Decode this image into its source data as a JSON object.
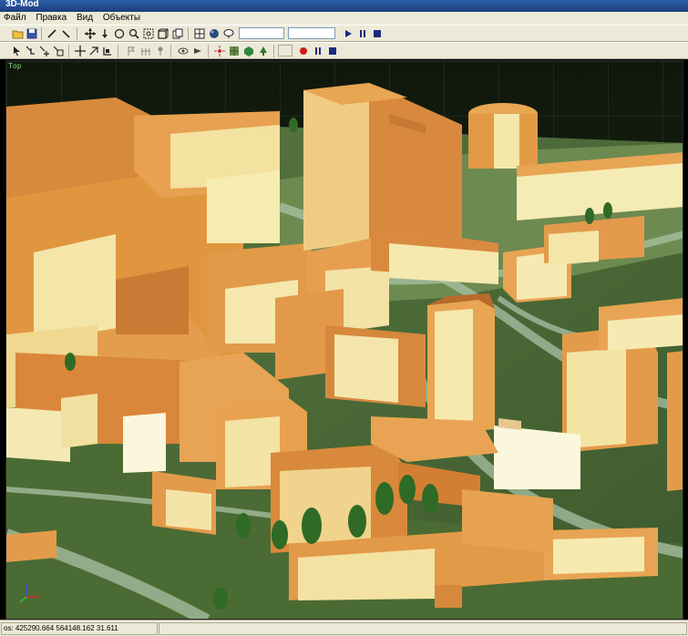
{
  "window": {
    "title": "3D-Mod"
  },
  "menu": [
    {
      "label": "Файл"
    },
    {
      "label": "Правка"
    },
    {
      "label": "Вид"
    },
    {
      "label": "Объекты"
    }
  ],
  "toolbar1": {
    "icons": [
      "open-icon",
      "save-icon",
      "line-icon",
      "polyline-icon",
      "pan-icon",
      "move-down-icon",
      "rotate-icon",
      "zoom-icon",
      "zoom-region-icon",
      "box-icon",
      "copy-icon",
      "grid-icon",
      "sphere-icon",
      "cloud-icon",
      "play-icon",
      "pause-icon",
      "stop-icon"
    ],
    "field1_value": "",
    "field2_value": ""
  },
  "toolbar2": {
    "icons": [
      "select-icon",
      "edit-node-icon",
      "move-node-icon",
      "scale-icon",
      "move-icon",
      "rotate-tool-icon",
      "resize-icon",
      "flag-icon",
      "fence-icon",
      "pin-icon",
      "eye-icon",
      "camera-icon",
      "explode-icon",
      "texture-icon",
      "cube-icon",
      "tree-icon",
      "record-icon",
      "pause-icon",
      "stop-icon"
    ]
  },
  "viewport": {
    "label": "Top"
  },
  "status": {
    "coordinates": "os: 425290.664 564148.162 31.611"
  },
  "colors": {
    "building_lit": "#f5f0b4",
    "building_roof": "#e8a855",
    "building_shadow": "#b8682c",
    "terrain": "#4d6b3a",
    "road": "#9ab79a"
  }
}
